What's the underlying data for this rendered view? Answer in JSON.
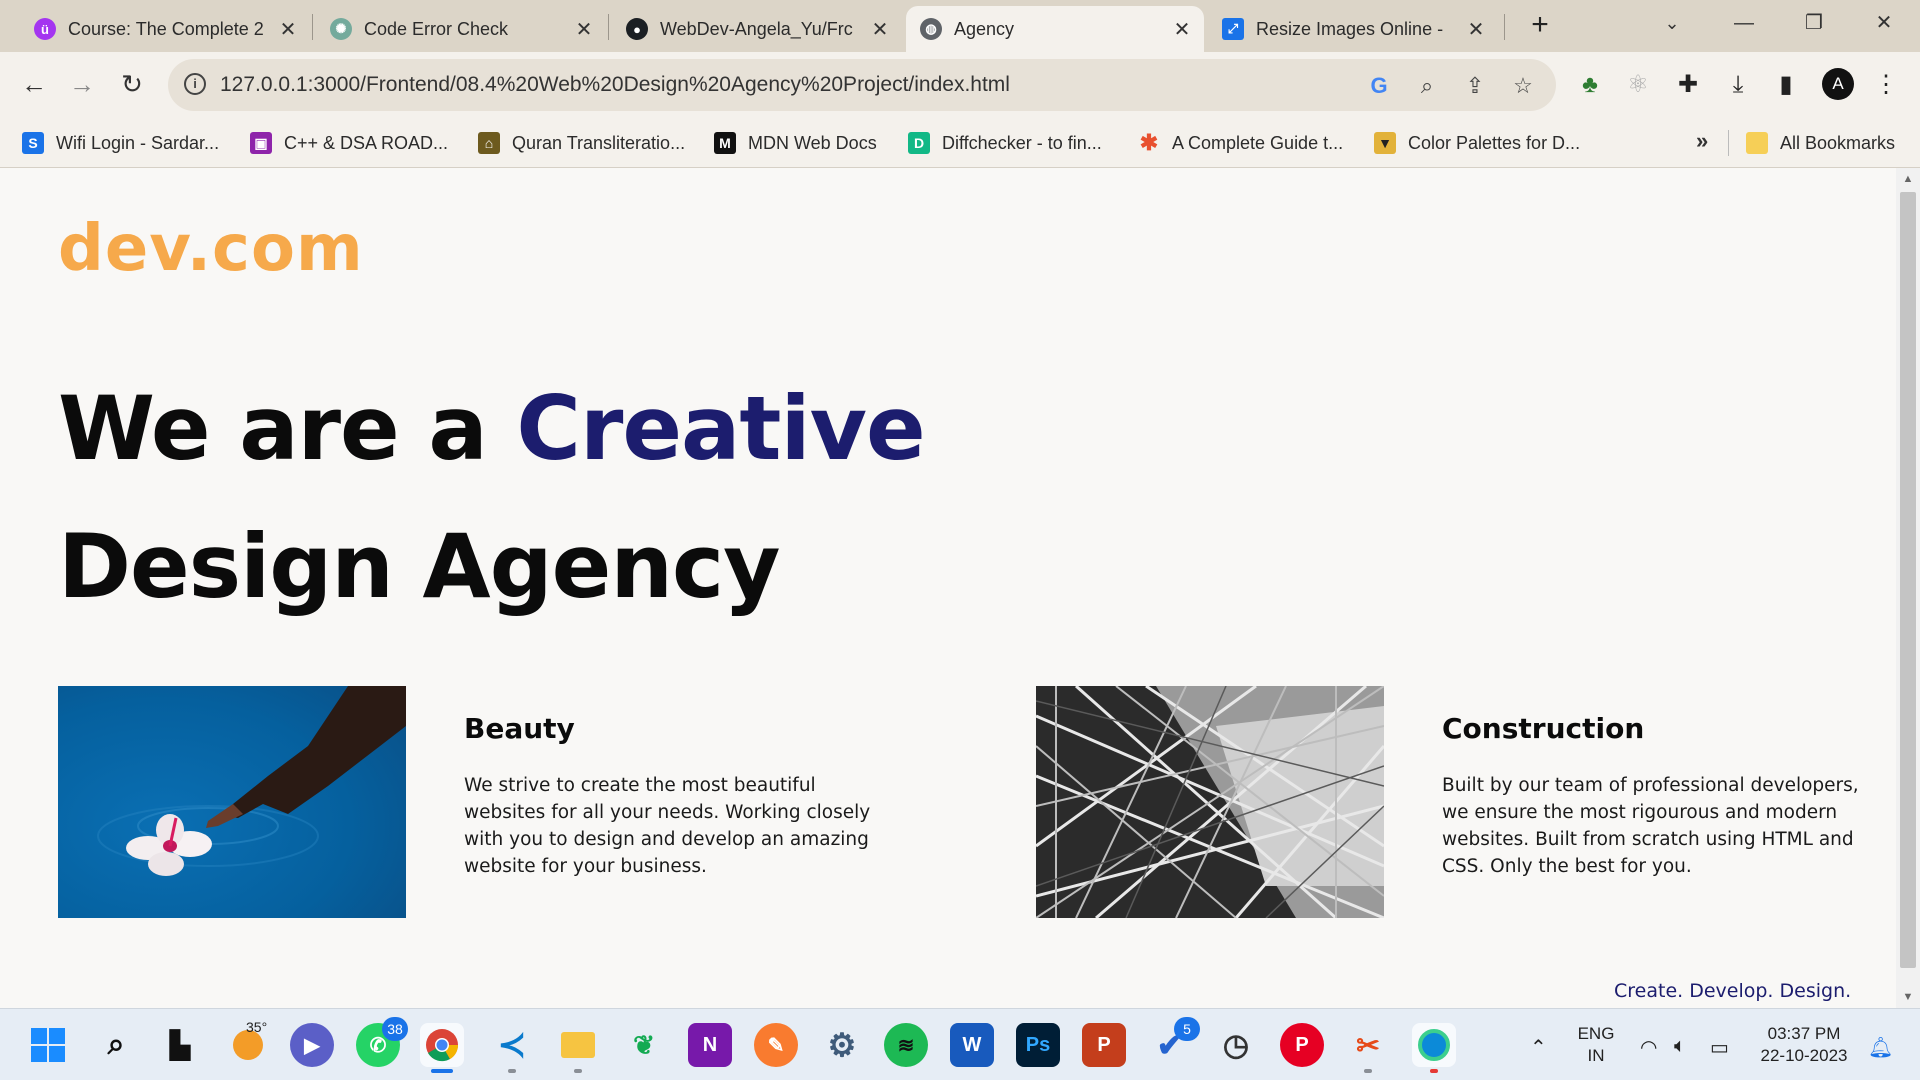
{
  "browser": {
    "tabs": [
      {
        "title": "Course: The Complete 2",
        "favicon": "udemy-icon",
        "color": "#a435f0"
      },
      {
        "title": "Code Error Check",
        "favicon": "chatgpt-icon",
        "color": "#74aa9c"
      },
      {
        "title": "WebDev-Angela_Yu/Frc",
        "favicon": "github-icon",
        "color": "#1b1f23"
      },
      {
        "title": "Agency",
        "favicon": "globe-icon",
        "color": "#5f6368",
        "active": true
      },
      {
        "title": "Resize Images Online -",
        "favicon": "resize-icon",
        "color": "#1a73e8"
      }
    ],
    "new_tab_glyph": "+",
    "window_controls": {
      "minimize": "—",
      "restore": "❐",
      "close": "✕"
    },
    "url": "127.0.0.1:3000/Frontend/08.4%20Web%20Design%20Agency%20Project/index.html",
    "profile_initial": "A",
    "bookmarks": [
      {
        "label": "Wifi Login - Sardar...",
        "icon": "wifi-login-icon",
        "color": "#1a73e8",
        "glyph": "S"
      },
      {
        "label": "C++ & DSA ROAD...",
        "icon": "presentation-icon",
        "color": "#8e24aa",
        "glyph": "▣"
      },
      {
        "label": "Quran Transliteratio...",
        "icon": "quran-icon",
        "color": "#6d5a1e",
        "glyph": "⌂"
      },
      {
        "label": "MDN Web Docs",
        "icon": "mdn-icon",
        "color": "#111111",
        "glyph": "M"
      },
      {
        "label": "Diffchecker - to fin...",
        "icon": "diffchecker-icon",
        "color": "#12b886",
        "glyph": "D"
      },
      {
        "label": "A Complete Guide t...",
        "icon": "css-tricks-icon",
        "color": "#e8502f",
        "glyph": "✱"
      },
      {
        "label": "Color Palettes for D...",
        "icon": "color-hunt-icon",
        "color": "#e2b23a",
        "glyph": "▼"
      }
    ],
    "bookmarks_overflow": "»",
    "all_bookmarks_label": "All Bookmarks"
  },
  "page": {
    "logo": "dev.com",
    "hero_line1_plain": "We are a ",
    "hero_line1_accent": "Creative",
    "hero_line2": "Design Agency",
    "cards": [
      {
        "title": "Beauty",
        "text": "We strive to create the most beautiful websites for all your needs. Working closely with you to design and develop an amazing website for your business.",
        "image": "flower-in-water-photo"
      },
      {
        "title": "Construction",
        "text": "Built by our team of professional developers, we ensure the most rigourous and modern websites. Built from scratch using HTML and CSS. Only the best for you.",
        "image": "steel-structure-photo"
      }
    ],
    "footer_tagline": "Create. Develop. Design.",
    "colors": {
      "logo": "#f6a94b",
      "accent": "#1c1d6e",
      "background": "#f9f8f6"
    }
  },
  "taskbar": {
    "weather_temp": "35°",
    "whatsapp_badge": "38",
    "todo_badge": "5",
    "language_line1": "ENG",
    "language_line2": "IN",
    "time": "03:37 PM",
    "date": "22-10-2023"
  }
}
